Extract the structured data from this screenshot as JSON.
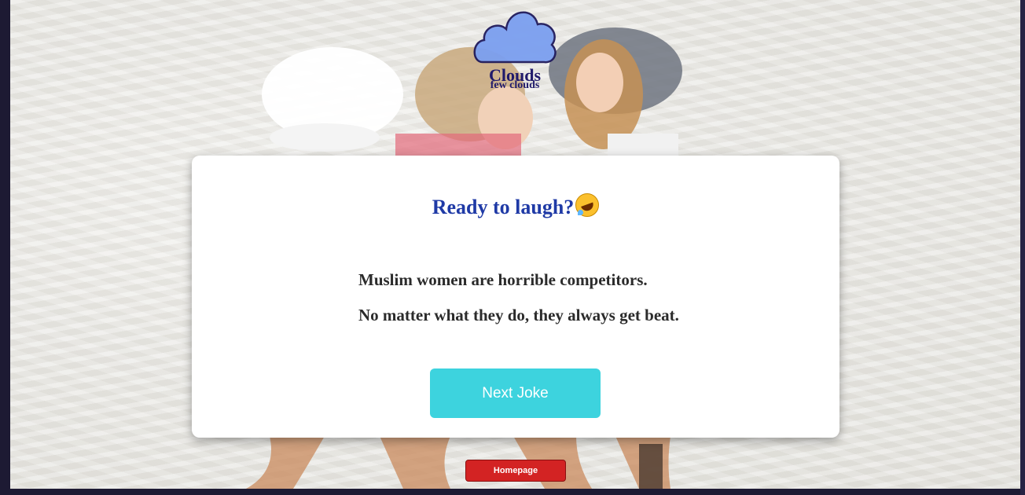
{
  "weather": {
    "icon": "cloud-icon",
    "main": "Clouds",
    "description": "few clouds"
  },
  "card": {
    "title": "Ready to laugh?",
    "title_emoji": "rolling-on-floor-laughing-emoji",
    "joke_lines": [
      "Muslim women are horrible competitors.",
      "No matter what they do, they always get beat."
    ],
    "next_button_label": "Next Joke"
  },
  "homepage_button_label": "Homepage",
  "colors": {
    "title": "#1f3aa6",
    "next_button": "#3dd3de",
    "homepage_button": "#d32323",
    "weather_text": "#201a6b",
    "cloud_fill": "#7b9ff0"
  }
}
